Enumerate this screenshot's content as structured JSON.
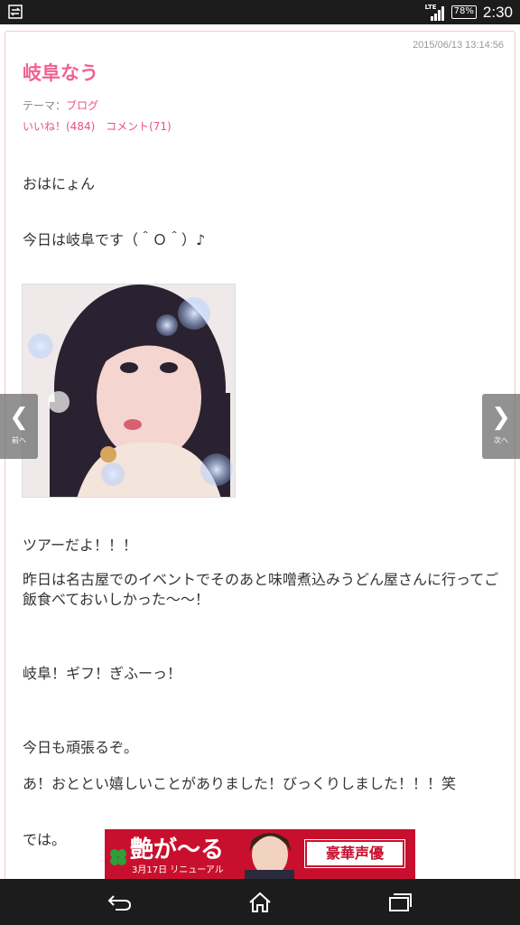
{
  "status_bar": {
    "network": "LTE",
    "battery": "78%",
    "time": "2:30",
    "icons": [
      "transfer-icon",
      "signal-icon",
      "battery-icon"
    ]
  },
  "post": {
    "timestamp": "2015/06/13 13:14:56",
    "title": "岐阜なう",
    "theme_label": "テーマ：",
    "theme_value": "ブログ",
    "likes": "いいね！(484)",
    "comments": "コメント(71)",
    "paragraphs": [
      "おはにょん",
      "今日は岐阜です（＾Ｏ＾）♪",
      "ツアーだよ！！！",
      "昨日は名古屋でのイベントでそのあと味噌煮込みうどん屋さんに行ってご飯食べておいしかった〜〜！",
      "岐阜！ギフ！ぎふーっ！",
      "今日も頑張るぞ。",
      "あ！おととい嬉しいことがありました！びっくりしました！！！笑",
      "では。"
    ]
  },
  "nav": {
    "prev_label": "前へ",
    "next_label": "次へ"
  },
  "ad": {
    "main_text": "艶が〜る",
    "date_text": "3月17日 リニューアル",
    "badge_text": "豪華声優"
  },
  "colors": {
    "accent": "#f06292",
    "link": "#e8528a",
    "ad_red": "#c8102e"
  }
}
